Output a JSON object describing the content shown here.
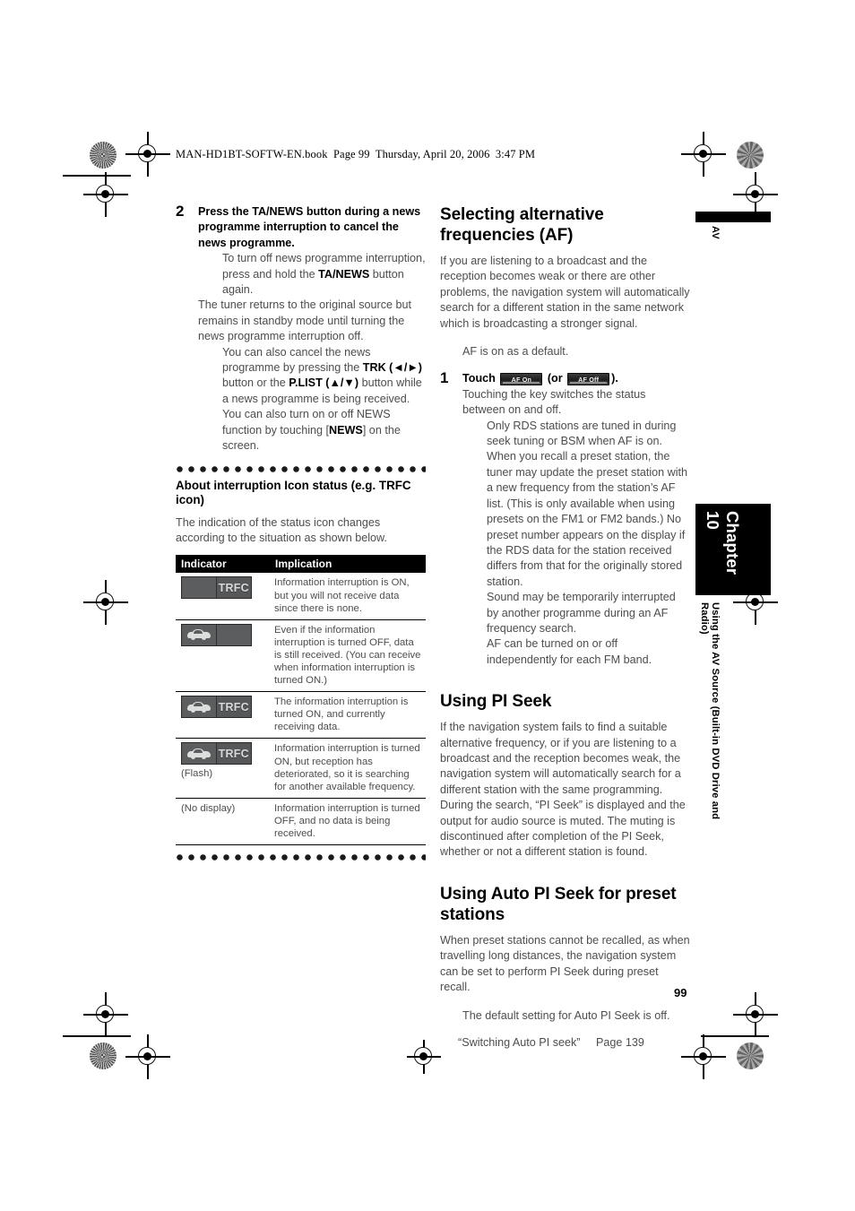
{
  "header": {
    "file_line": "MAN-HD1BT-SOFTW-EN.book  Page 99  Thursday, April 20, 2006  3:47 PM"
  },
  "left_column": {
    "step2": {
      "number": "2",
      "bold_lead": "Press the TA/NEWS button during a news programme interruption to cancel the news programme.",
      "note1": "To turn off news programme interruption, press and hold the TA/NEWS button again.",
      "para1": "The tuner returns to the original source but remains in standby mode until turning the news programme interruption off.",
      "note2": "You can also cancel the news programme by pressing the TRK (◄/►) button or the P.LIST (▲/▼) button while a news programme is being received.",
      "note3": "You can also turn on or off NEWS function by touching [NEWS] on the screen."
    },
    "interruption_section": {
      "heading": "About interruption Icon status (e.g. TRFC icon)",
      "intro": "The indication of the status icon changes according to the situation as shown below.",
      "table": {
        "headers": [
          "Indicator",
          "Implication"
        ],
        "rows": [
          {
            "indicator_type": "chip",
            "chip_left": "blank",
            "chip_right": "TRFC",
            "caption": "",
            "implication": "Information interruption is ON, but you will not receive data since there is none."
          },
          {
            "indicator_type": "chip",
            "chip_left": "car",
            "chip_right": "",
            "caption": "",
            "implication": "Even if the information interruption is turned OFF, data is still received. (You can receive when information interruption is turned ON.)"
          },
          {
            "indicator_type": "chip",
            "chip_left": "car",
            "chip_right": "TRFC",
            "caption": "",
            "implication": "The information interruption is turned ON, and currently receiving data."
          },
          {
            "indicator_type": "chip",
            "chip_left": "car",
            "chip_right": "TRFC",
            "caption": "(Flash)",
            "implication": "Information interruption is turned ON, but reception has deteriorated, so it is searching for another available frequency."
          },
          {
            "indicator_type": "text",
            "chip_left": "",
            "chip_right": "",
            "caption": "(No display)",
            "implication": "Information interruption is turned OFF, and no data is being received."
          }
        ]
      }
    }
  },
  "right_column": {
    "af_section": {
      "heading": "Selecting alternative frequencies (AF)",
      "para1": "If you are listening to a broadcast and the reception becomes weak or there are other problems, the navigation system will automatically search for a different station in the same network which is broadcasting a stronger signal.",
      "note_default": "AF is on as a default.",
      "step1": {
        "number": "1",
        "touch_label": "Touch",
        "key_on": "AF On",
        "or_text": "(or",
        "key_off": "AF Off",
        "close_text": ").",
        "body": "Touching the key switches the status between on and off.",
        "notes": [
          "Only RDS stations are tuned in during seek tuning or BSM when AF is on.",
          "When you recall a preset station, the tuner may update the preset station with a new frequency from the station’s AF list. (This is only available when using presets on the FM1 or FM2 bands.) No preset number appears on the display if the RDS data for the station received differs from that for the originally stored station.",
          "Sound may be temporarily interrupted by another programme during an AF frequency search.",
          "AF can be turned on or off independently for each FM band."
        ]
      }
    },
    "pi_seek_section": {
      "heading": "Using PI Seek",
      "para1": "If the navigation system fails to find a suitable alternative frequency, or if you are listening to a broadcast and the reception becomes weak, the navigation system will automatically search for a different station with the same programming. During the search, “PI Seek” is displayed and the output for audio source is muted. The muting is discontinued after completion of the PI Seek, whether or not a different station is found."
    },
    "auto_pi_section": {
      "heading": "Using Auto PI Seek for preset stations",
      "para1": "When preset stations cannot be recalled, as when travelling long distances, the navigation system can be set to perform PI Seek during preset recall.",
      "note": "The default setting for Auto PI Seek is off.",
      "xref_title": "“Switching Auto PI seek”",
      "xref_page": "Page 139"
    }
  },
  "margin": {
    "av_label": "AV",
    "chapter_label": "Chapter 10",
    "chapter_title": "Using the AV Source (Built-in DVD Drive and Radio)",
    "page_number": "99"
  }
}
